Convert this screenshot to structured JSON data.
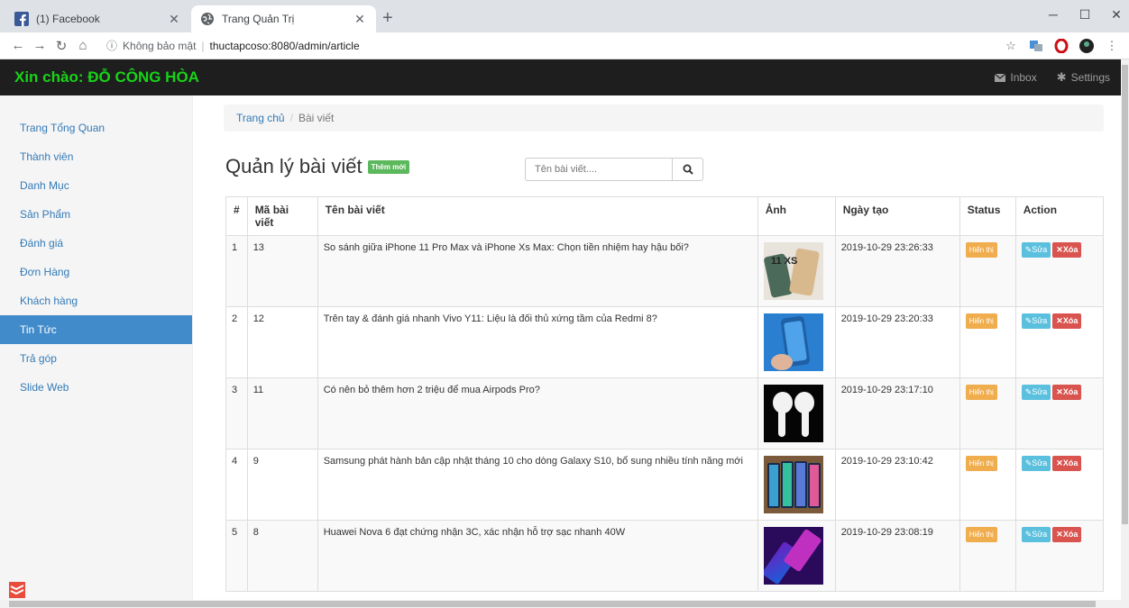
{
  "browser": {
    "tabs": [
      {
        "title": "(1) Facebook",
        "icon": "facebook-icon",
        "active": false
      },
      {
        "title": "Trang Quản Trị",
        "icon": "globe-icon",
        "active": true
      }
    ],
    "url_info": "Không bảo mật",
    "url": "thuctapcoso:8080/admin/article"
  },
  "header": {
    "greeting": "Xin chào: ĐỖ CÔNG HÒA",
    "inbox_label": "Inbox",
    "settings_label": "Settings"
  },
  "sidebar": {
    "items": [
      {
        "label": "Trang Tổng Quan"
      },
      {
        "label": "Thành viên"
      },
      {
        "label": "Danh Mục"
      },
      {
        "label": "Sản Phẩm"
      },
      {
        "label": "Đánh giá"
      },
      {
        "label": "Đơn Hàng"
      },
      {
        "label": "Khách hàng"
      },
      {
        "label": "Tin Tức"
      },
      {
        "label": "Trả góp"
      },
      {
        "label": "Slide Web"
      }
    ],
    "active_index": 7
  },
  "breadcrumb": {
    "home": "Trang chủ",
    "current": "Bài viết"
  },
  "page": {
    "title": "Quản lý bài viết",
    "add_label": "Thêm mới",
    "search_placeholder": "Tên bài viết...."
  },
  "table": {
    "headers": [
      "#",
      "Mã bài viết",
      "Tên bài viết",
      "Ảnh",
      "Ngày tạo",
      "Status",
      "Action"
    ],
    "status_label": "Hiển thị",
    "edit_label": "Sửa",
    "delete_label": "Xóa",
    "rows": [
      {
        "idx": "1",
        "id": "13",
        "title": "So sánh giữa iPhone 11 Pro Max và iPhone Xs Max: Chọn tiền nhiệm hay hậu bối?",
        "date": "2019-10-29 23:26:33",
        "thumb_label": "11 XS"
      },
      {
        "idx": "2",
        "id": "12",
        "title": "Trên tay & đánh giá nhanh Vivo Y11: Liệu là đối thủ xứng tầm của Redmi 8?",
        "date": "2019-10-29 23:20:33",
        "thumb_label": ""
      },
      {
        "idx": "3",
        "id": "11",
        "title": "Có nên bỏ thêm hơn 2 triệu để mua Airpods Pro?",
        "date": "2019-10-29 23:17:10",
        "thumb_label": ""
      },
      {
        "idx": "4",
        "id": "9",
        "title": "Samsung phát hành bản cập nhật tháng 10 cho dòng Galaxy S10, bổ sung nhiều tính năng mới",
        "date": "2019-10-29 23:10:42",
        "thumb_label": ""
      },
      {
        "idx": "5",
        "id": "8",
        "title": "Huawei Nova 6 đạt chứng nhận 3C, xác nhận hỗ trợ sạc nhanh 40W",
        "date": "2019-10-29 23:08:19",
        "thumb_label": ""
      }
    ]
  },
  "colors": {
    "greeting": "#18d418",
    "sidebar_active": "#428bca",
    "add_button": "#5cb85c",
    "status_badge": "#f0ad4e",
    "edit_button": "#5bc0de",
    "delete_button": "#d9534f"
  }
}
